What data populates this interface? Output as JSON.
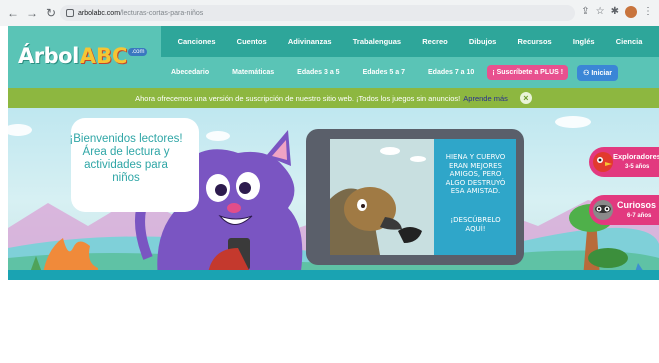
{
  "browser": {
    "back_icon": "arrow-left-icon",
    "forward_icon": "arrow-right-icon",
    "reload_icon": "reload-icon",
    "url_host": "arbolabc.com",
    "url_path": "/lecturas-cortas-para-niños"
  },
  "site": {
    "logo_text": "Árbol",
    "logo_abc": "ABC",
    "logo_com": ".com",
    "menu_top": [
      "Canciones",
      "Cuentos",
      "Adivinanzas",
      "Trabalenguas",
      "Recreo",
      "Dibujos",
      "Recursos",
      "Inglés",
      "Ciencia"
    ],
    "menu_bottom": [
      "Abecedario",
      "Matemáticas",
      "Edades 3 a 5",
      "Edades 5 a 7",
      "Edades 7 a 10"
    ],
    "plus_button": "¡ Suscríbete a PLUS !",
    "login_button": "Iniciar"
  },
  "announcement": {
    "text": "Ahora ofrecemos una versión de suscripción de nuestro sitio web. ¡Todos los juegos sin anuncios!",
    "link": "Aprende más",
    "close": "×"
  },
  "hero": {
    "bubble_lines": [
      "¡Bienvenidos lectores!",
      "Área de lectura y",
      "actividades para",
      "niños"
    ],
    "tablet_lines": [
      "HIENA Y CUERVO",
      "ERAN MEJORES",
      "AMIGOS, PERO",
      "ALGO DESTRUYÓ",
      "ESA AMISTAD."
    ],
    "tablet_cta_lines": [
      "¡DESCÚBRELO",
      "AQUÍ!"
    ],
    "explorers_title": "Exploradores",
    "explorers_sub": "3-5 años",
    "curious_title": "Curiosos",
    "curious_sub": "6-7 años"
  },
  "colors": {
    "header": "#5ac4b6",
    "menu": "#2ea69a",
    "announcement": "#8db740",
    "plus": "#e8518f",
    "login": "#3b86d6",
    "cta": "#e2397f"
  }
}
